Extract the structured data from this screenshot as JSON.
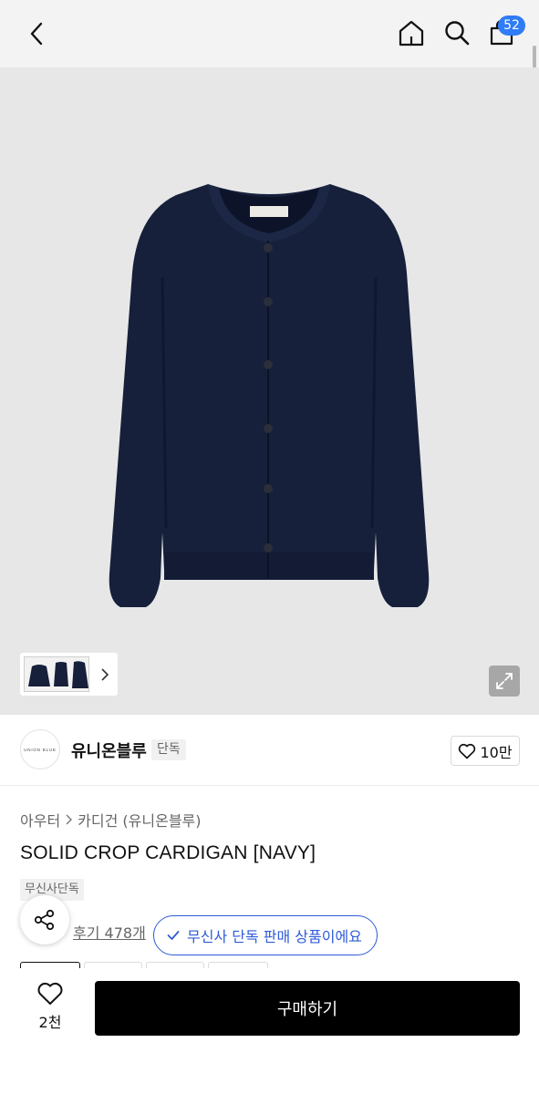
{
  "header": {
    "cart_count": "52",
    "icons": [
      "back-icon",
      "home-icon",
      "search-icon",
      "cart-icon"
    ]
  },
  "gallery": {
    "thumb_count_colors": "#16203a",
    "icons": [
      "chevron-right-icon",
      "expand-icon"
    ]
  },
  "brand": {
    "logo_text": "UNION BLUE",
    "name": "유니온블루",
    "tag": "단독",
    "likes": "10만"
  },
  "product": {
    "breadcrumb": [
      "아우터",
      "카디건 (유니온블루)"
    ],
    "title": "SOLID CROP CARDIGAN [NAVY]",
    "exclusive_tag": "무신사단독",
    "reviews": "후기 478개",
    "exclusive_notice": "무신사 단독 판매 상품이에요"
  },
  "bottom": {
    "wish_count": "2천",
    "buy_label": "구매하기"
  },
  "colors": {
    "accent_blue": "#2f5bd6",
    "badge_blue": "#2f7cf6",
    "cardigan_navy": "#16203a"
  }
}
